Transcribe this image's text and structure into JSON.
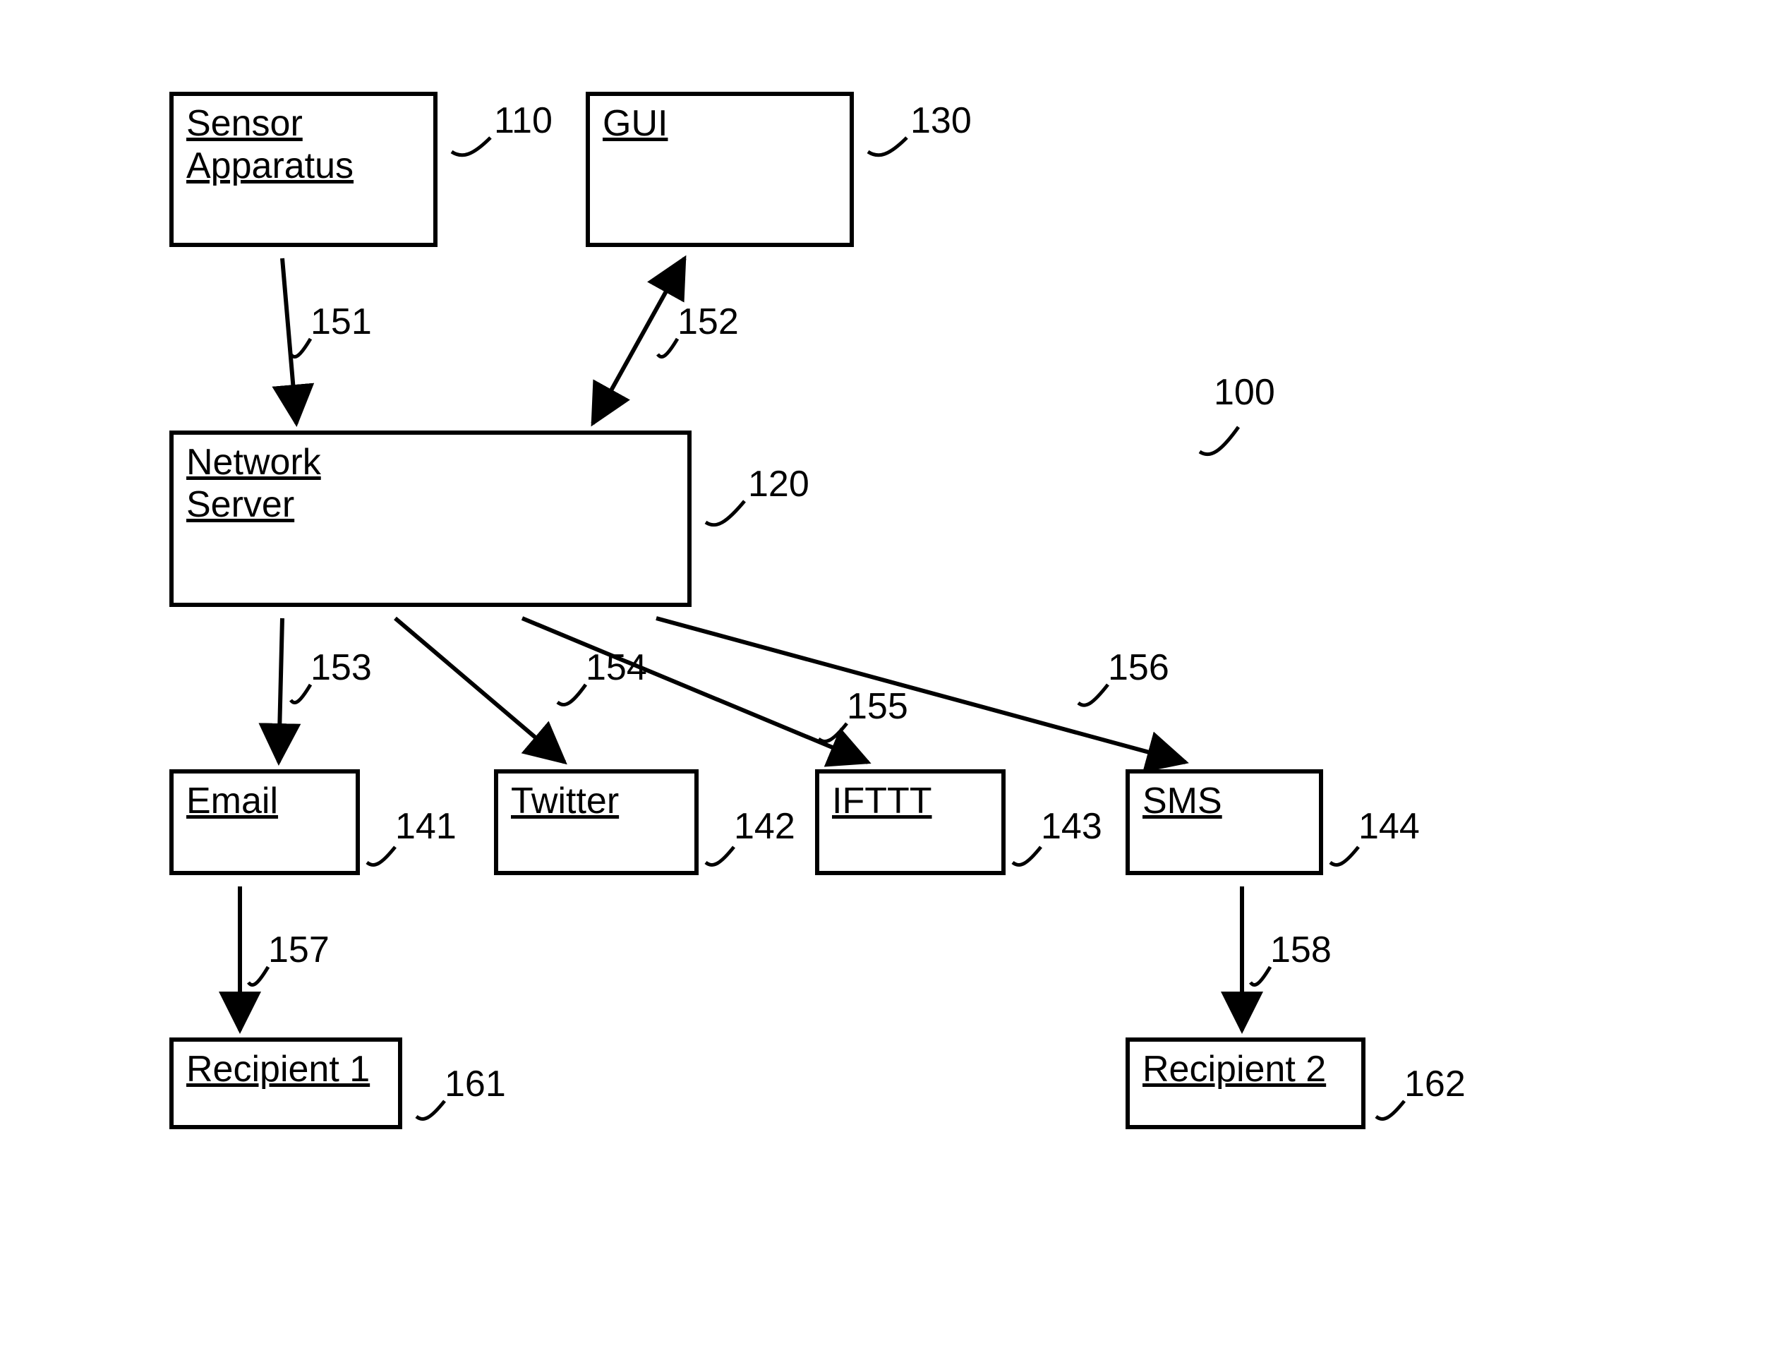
{
  "diagram": {
    "system_ref": "100",
    "nodes": {
      "sensor": {
        "label": "Sensor\nApparatus",
        "ref": "110"
      },
      "gui": {
        "label": "GUI",
        "ref": "130"
      },
      "server": {
        "label": "Network\nServer",
        "ref": "120"
      },
      "email": {
        "label": "Email",
        "ref": "141"
      },
      "twitter": {
        "label": "Twitter",
        "ref": "142"
      },
      "ifttt": {
        "label": "IFTTT",
        "ref": "143"
      },
      "sms": {
        "label": "SMS",
        "ref": "144"
      },
      "recipient1": {
        "label": "Recipient 1",
        "ref": "161"
      },
      "recipient2": {
        "label": "Recipient 2",
        "ref": "162"
      }
    },
    "edges": {
      "sensor_server": {
        "ref": "151"
      },
      "gui_server": {
        "ref": "152"
      },
      "server_email": {
        "ref": "153"
      },
      "server_twitter": {
        "ref": "154"
      },
      "server_ifttt": {
        "ref": "155"
      },
      "server_sms": {
        "ref": "156"
      },
      "email_rec1": {
        "ref": "157"
      },
      "sms_rec2": {
        "ref": "158"
      }
    }
  }
}
